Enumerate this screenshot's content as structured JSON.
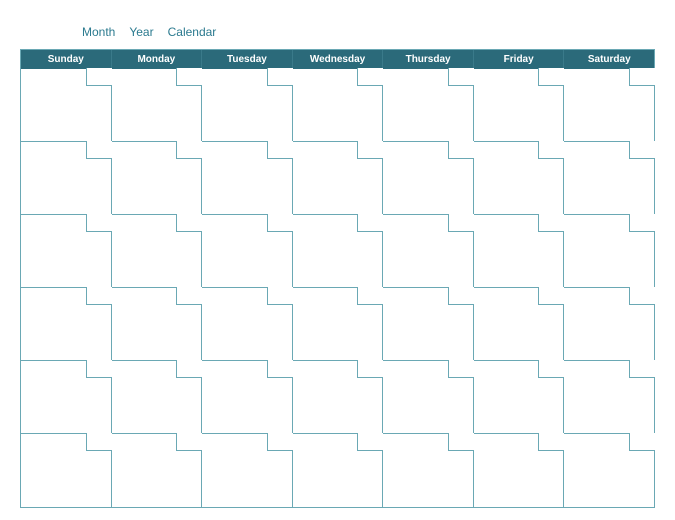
{
  "title": {
    "month_label": "Month",
    "year_label": "Year",
    "calendar_label": "Calendar"
  },
  "days": {
    "d0": "Sunday",
    "d1": "Monday",
    "d2": "Tuesday",
    "d3": "Wednesday",
    "d4": "Thursday",
    "d5": "Friday",
    "d6": "Saturday"
  }
}
